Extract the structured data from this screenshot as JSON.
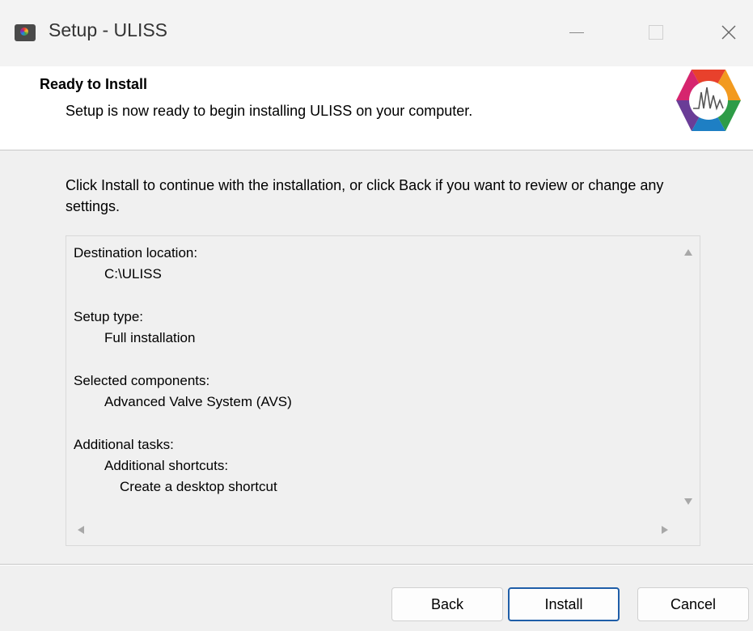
{
  "window": {
    "title": "Setup - ULISS"
  },
  "header": {
    "title": "Ready to Install",
    "subtitle": "Setup is now ready to begin installing ULISS on your computer."
  },
  "body": {
    "instruction": "Click Install to continue with the installation, or click Back if you want to review or change any settings."
  },
  "summary": {
    "lines": [
      "Destination location:",
      "C:\\ULISS",
      "Setup type:",
      "Full installation",
      "Selected components:",
      "Advanced Valve System (AVS)",
      "Additional tasks:",
      "Additional shortcuts:",
      "Create a desktop shortcut"
    ]
  },
  "buttons": {
    "back": "Back",
    "install": "Install",
    "cancel": "Cancel"
  },
  "icons": {
    "app": "app-camera-icon",
    "logo": "uliss-hexagon-logo",
    "minimize": "minimize-icon",
    "maximize": "maximize-icon",
    "close": "close-icon"
  },
  "colors": {
    "accent_border": "#1f5ea8",
    "header_bg": "#ffffff",
    "window_bg": "#f0f0f0"
  }
}
